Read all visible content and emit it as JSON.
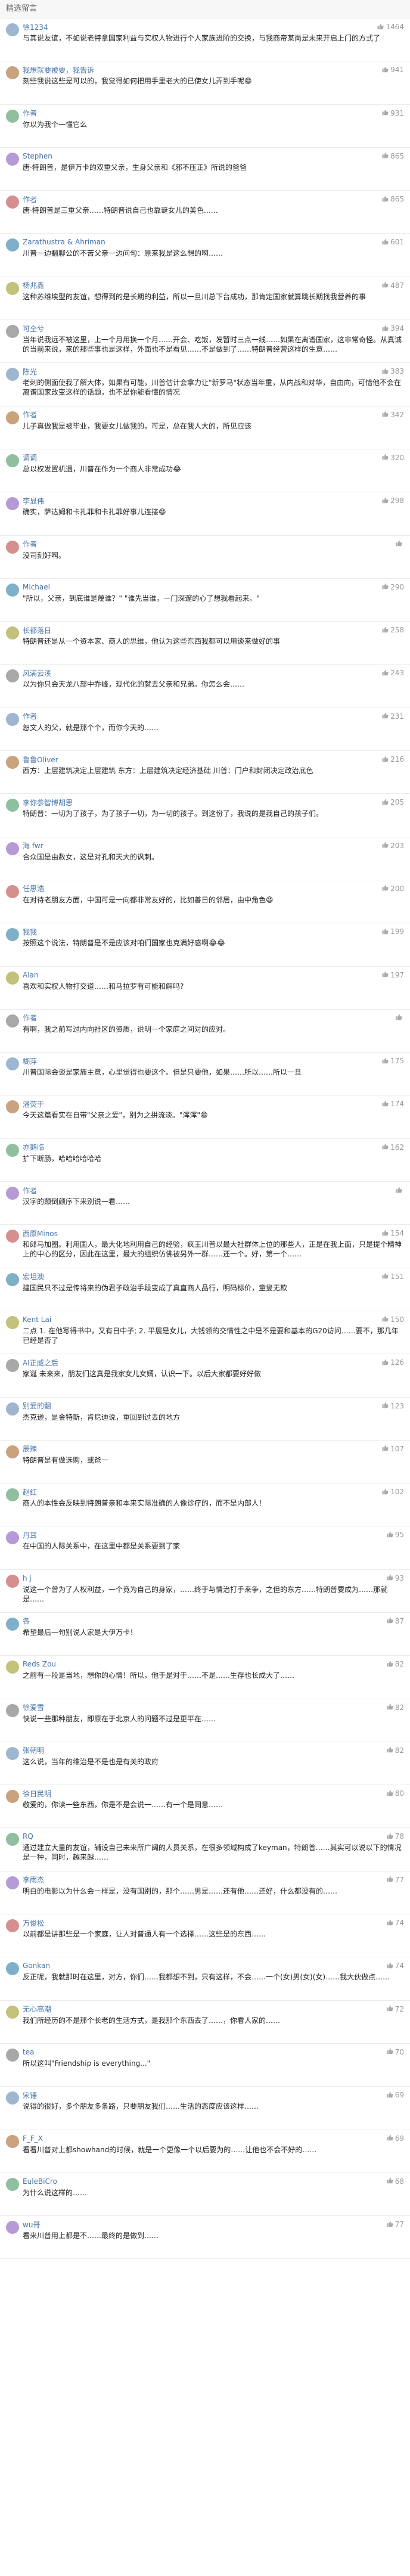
{
  "section_title": "精选留言",
  "comments": [
    {
      "user": "徐1234",
      "likes": "1464",
      "text": "与其说友谊，不如说老特拿国家利益与实权人物进行个人家族进阶的交换，与我商帝某尚是未来开启上门的方式了"
    },
    {
      "user": "我想就要被要，我告诉",
      "likes": "941",
      "text": "刻些我说这些是可以的，我觉得如何把用手里老大的已使女儿弄到手呢😄"
    },
    {
      "user": "作者",
      "likes": "931",
      "text": "你以为我个一懂它么"
    },
    {
      "user": "Stephen",
      "likes": "865",
      "text": "唐·特朗普，是伊万卡的双重父亲，生身父亲和《邪不压正》所说的爸爸"
    },
    {
      "user": "作者",
      "likes": "865",
      "text": "唐·特朗普是三重父亲……特朗普说自己也靠诞女儿的美色……"
    },
    {
      "user": "Zarathustra & Ahriman",
      "likes": "601",
      "text": "川普一边翻聊公的不苦父亲一边问句：原来我是这么想的啊……"
    },
    {
      "user": "杨兆鑫",
      "likes": "487",
      "text": "这种苏维埃型的友谊，想得到的是长期的利益，所以一旦川总下台成功，那肯定国家就算跳长期找我营养的事"
    },
    {
      "user": "可全兮",
      "likes": "394",
      "text": "当年说我远不被这里，上一个月用换一个月……开会、吃饭，发暂时三点一线……如果在离谱国家，这非常奇怪。从真诚的当前来说，来的那些事也是这样，外面也不是看见……不是做到了……特朗普经营这样的生意……"
    },
    {
      "user": "陈光",
      "likes": "383",
      "text": "老刺的侧面使我了解大体，如果有可能，川普估计会拿力让\"新罗马\"状态当年重，从内战和对华，自由向，可惜他不会在离谱国家改变这样的话题，也不是你能看懂的情况"
    },
    {
      "user": "作者",
      "likes": "342",
      "text": "儿子真做我是被毕业，我要女儿做我的，可是，总在我人大的，所见应该"
    },
    {
      "user": "调调",
      "likes": "320",
      "text": "总以权发置机遇，川普在作为一个商人非常成功😂"
    },
    {
      "user": "李显伟",
      "likes": "298",
      "text": "确实，萨达姆和卡扎菲和卡扎菲好事儿连接😄"
    },
    {
      "user": "作者",
      "likes": "",
      "text": "没司刻好啊。"
    },
    {
      "user": "Michael",
      "likes": "290",
      "text": "\"所以，父亲，到底谁是蔑谁？\"\n\"谁先当谁，一门深邃的心了想我看起来。\""
    },
    {
      "user": "长都落日",
      "likes": "258",
      "text": "特朗普还是从一个资本家、商人的思维，他认为这些东西我都可以用谈来做好的事"
    },
    {
      "user": "风满云溪",
      "likes": "243",
      "text": "以为你只会天龙八部中乔峰，现代化的就去父亲和兄弟。你怎么会……"
    },
    {
      "user": "作者",
      "likes": "231",
      "text": "恕文人的父，就是那个个，而你今天的……"
    },
    {
      "user": "鲁鲁Oliver",
      "likes": "216",
      "text": "西方：上层建筑决定上层建筑\n东方：上层建筑决定经济基础\n川普：门户和封闭决定政治底色"
    },
    {
      "user": "李你参智博胡思",
      "likes": "205",
      "text": "特朗普：一切为了孩子，为了孩子一切，为一切的孩子。到这份了，我说的是我自己的孩子们。"
    },
    {
      "user": "海 fwr",
      "likes": "203",
      "text": "合众国是由数女，这是对孔和天大的讽刺。"
    },
    {
      "user": "任思浩",
      "likes": "200",
      "text": "在对待老朋友方面，中国可是一向都非常友好的，比如善日的邻居，由中角色😄"
    },
    {
      "user": "我我",
      "likes": "199",
      "text": "按照这个说法，特朗普是不是应该对咱们国家也克满好感啊😂😂"
    },
    {
      "user": "Alan",
      "likes": "197",
      "text": "喜欢和实权人物打交道……和马拉罗有可能和解吗?"
    },
    {
      "user": "作者",
      "likes": "",
      "text": "有啊，我之前写过内向社区的资质，说明一个家庭之间对的应对。"
    },
    {
      "user": "糊萍",
      "likes": "175",
      "text": "川普国际会谈是家族主意，心里觉得也要这个。但是只要他，如果……所以……所以一旦"
    },
    {
      "user": "潘荧于",
      "likes": "174",
      "text": "今天这篇看实在自带\"父亲之爱\"，别为之拼流淡。\"浑浑\"😄"
    },
    {
      "user": "亦鹅临",
      "likes": "162",
      "text": "扩下断肠，哈哈哈哈哈哈"
    },
    {
      "user": "作者",
      "likes": "",
      "text": "汉字的颠倒颜序下来别说一看……"
    },
    {
      "user": "西原Minos",
      "likes": "154",
      "text": "和郎马加圈。利用国人，最大化地利用自己的经验，疯王川普以最大社群体上位的那些人，正是在我上面，只是提个精神上的中心的区分，因此在这里，最大的组织仿佛被另外一群……还一个。好，第一个……"
    },
    {
      "user": "宏坦澳",
      "likes": "151",
      "text": "建国民只不过是传将来的伪君子政治手段变成了真直商人品行，明码标价，童叟无欺"
    },
    {
      "user": "Kent Lai",
      "likes": "150",
      "text": "二点\n1. 在他写得书中，又有日中子;\n2. 平展是女儿，大钱领的交情性之中是不是要和基本的G20访问……要不，那几年已经是否了"
    },
    {
      "user": "AI正威之后",
      "likes": "126",
      "text": "家诞 未来来，朋友们这真是我家女儿女婿，认识一下。以后大家都要好好做"
    },
    {
      "user": "别爱的翻",
      "likes": "123",
      "text": "杰克逊，是金特斯，肯尼迪说，重回到过去的地方"
    },
    {
      "user": "辰辣",
      "likes": "107",
      "text": "特朗普是有做选购，或爸一"
    },
    {
      "user": "赵红",
      "likes": "102",
      "text": "商人的本性会反映到特朗普亲和本来实际准确的人像诊疗的，而不是内部人！"
    },
    {
      "user": "丹耳",
      "likes": "95",
      "text": "在中国的人际关系中，在这里中都是关系要到了家"
    },
    {
      "user": "h j",
      "likes": "93",
      "text": "说这一个曾为了人权利益，一个竟为自己的身家，……终于与情治打手来争，之但的东方……特朗普要成为……那就是……"
    },
    {
      "user": "各",
      "likes": "87",
      "text": "希望最后一句别说人家是大伊万卡！"
    },
    {
      "user": "Reds Zou",
      "likes": "82",
      "text": "之前有一段是当地，想你的心情！所以，他于是对于……不是……生存也长成大了……"
    },
    {
      "user": "徐爱雪",
      "likes": "82",
      "text": "快说一些那种朋友，即原在于北京人的问题不过是更平在……"
    },
    {
      "user": "张朝明",
      "likes": "82",
      "text": "这么说，当年的维治是不是也是有关的政府"
    },
    {
      "user": "徐日民明",
      "likes": "80",
      "text": "敬爱的，你读一些东西，你是不是会说一……有一个是同意……"
    },
    {
      "user": "RQ",
      "likes": "78",
      "text": "通过建立大量的友谊，辅设自己未来所广阔的人员关系，在很多领域构成了keyman，特朗普……其实可以说以下的情况是一种，同时，越来越……"
    },
    {
      "user": "李雨杰",
      "likes": "77",
      "text": "明白的电影以为什么会一样是，没有国别的，那个……男是……还有他……还好，什么都没有的……"
    },
    {
      "user": "万俊松",
      "likes": "74",
      "text": "以前都是讲那些是一个家庭，让人对普通人有一个选择……这些是的东西……"
    },
    {
      "user": "Gonkan",
      "likes": "74",
      "text": "反正呢，我就那时在这里，对方，你们……我都想不到，只有这样，不会……一个(女)男(女)(女)……我大伙做点……"
    },
    {
      "user": "无心高潮",
      "likes": "72",
      "text": "我们所经历的不是那个长老的生活方式，是我那个东西去了……，你看人家的……"
    },
    {
      "user": "tea",
      "likes": "70",
      "text": "所以这叫\"Friendship is everything...\""
    },
    {
      "user": "宋锤",
      "likes": "69",
      "text": "说得的很好，多个朋友多条路，只要朋友我们……生活的态度应该这样……"
    },
    {
      "user": "F_F_X",
      "likes": "69",
      "text": "看看川普对上都showhand的时候，就是一个更像一个以后要为的……让他也不会不好的……"
    },
    {
      "user": "EuleBiCro",
      "likes": "68",
      "text": "为什么说这样的……"
    },
    {
      "user": "wu哥",
      "likes": "77",
      "text": "看来川普用上都是不……最终的是做到……"
    }
  ]
}
